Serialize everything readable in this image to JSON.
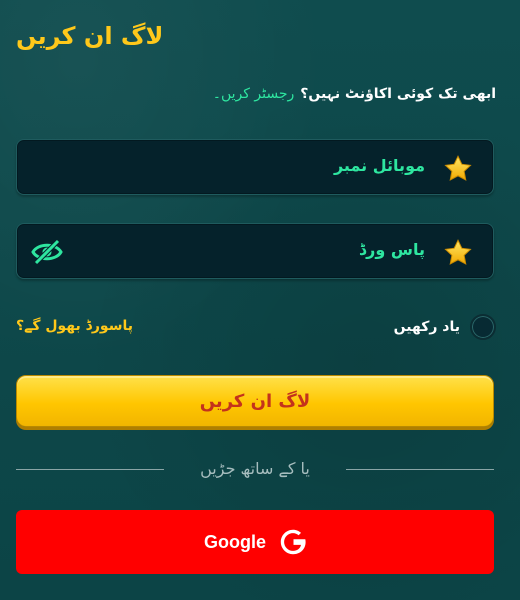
{
  "header": {
    "title": "لاگ ان کریں"
  },
  "register": {
    "prompt": "ابھی تک کوئی اکاؤنٹ نہیں؟",
    "link": "رجسٹر کریں۔"
  },
  "fields": {
    "mobile": {
      "label": "موبائل نمبر",
      "icon": "star-icon"
    },
    "password": {
      "label": "پاس ورڈ",
      "icon": "star-icon",
      "toggle_icon": "eye-slash-icon"
    }
  },
  "options": {
    "remember_label": "یاد رکھیں",
    "forgot_label": "پاسورڈ بھول گے؟"
  },
  "login_button": {
    "label": "لاگ ان کریں"
  },
  "divider": {
    "label": "یا کے ساتھ جڑیں"
  },
  "google_button": {
    "label": "Google",
    "icon": "google-g-icon"
  },
  "colors": {
    "accent_yellow": "#ffc81a",
    "accent_green": "#2ee6a0",
    "google_red": "#ff0000",
    "login_text": "#c4321c",
    "background": "#0e4a4c"
  }
}
